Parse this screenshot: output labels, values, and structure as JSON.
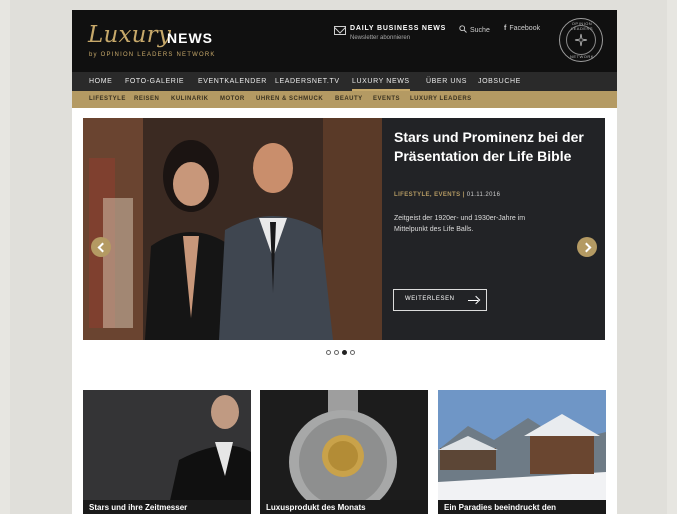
{
  "logo": {
    "luxury": "Luxury",
    "news": "NEWS",
    "sub": "by OPINION LEADERS NETWORK"
  },
  "header": {
    "dbn_title": "DAILY BUSINESS NEWS",
    "dbn_sub": "Newsletter abonnieren",
    "search": "Suche",
    "facebook": "Facebook",
    "seal_top": "OPINION LEADERS",
    "seal_bottom": "NETWORK"
  },
  "nav": [
    "HOME",
    "FOTO-GALERIE",
    "EVENTKALENDER",
    "LEADERSNET.TV",
    "LUXURY NEWS",
    "ÜBER UNS",
    "JOBSUCHE"
  ],
  "nav_active": "LUXURY NEWS",
  "subnav": [
    "LIFESTYLE",
    "REISEN",
    "KULINARIK",
    "MOTOR",
    "UHREN & SCHMUCK",
    "BEAUTY",
    "EVENTS",
    "LUXURY LEADERS"
  ],
  "hero": {
    "title": "Stars und Prominenz bei der Präsentation der Life Bible",
    "category": "LIFESTYLE, EVENTS",
    "date": "01.11.2016",
    "text": "Zeitgeist der 1920er- und 1930er-Jahre im Mittelpunkt des Life Balls.",
    "button": "WEITERLESEN"
  },
  "carousel": {
    "count": 4,
    "active": 3
  },
  "cards": [
    {
      "caption": "Stars und ihre Zeitmesser"
    },
    {
      "caption": "Luxusprodukt des Monats"
    },
    {
      "caption": "Ein Paradies beeindruckt den"
    }
  ],
  "colors": {
    "gold": "#b49a63",
    "header_bg": "#101010",
    "nav_bg": "#2a2a2a"
  }
}
